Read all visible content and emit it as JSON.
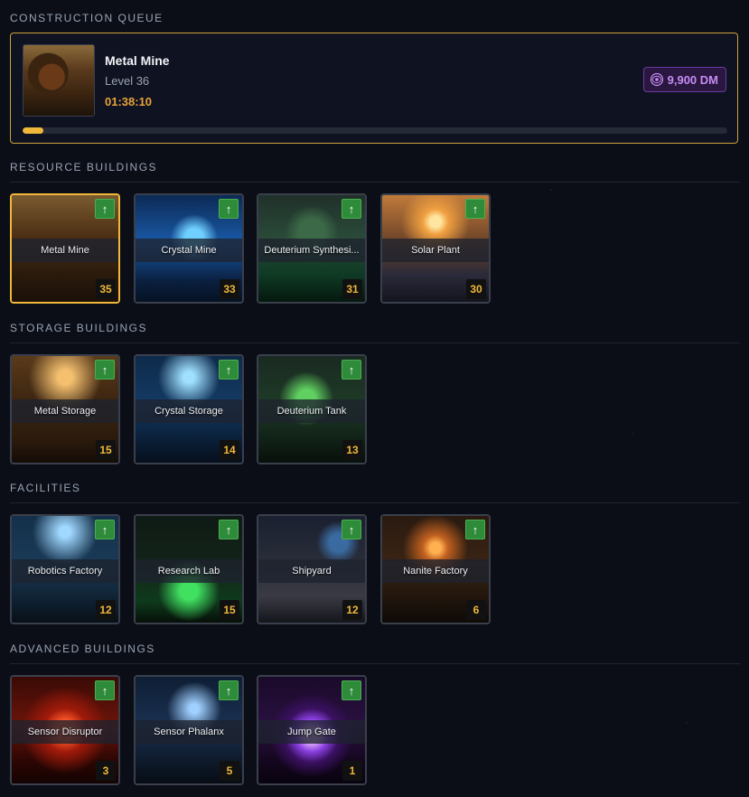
{
  "queue": {
    "section_title": "CONSTRUCTION QUEUE",
    "building_name": "Metal Mine",
    "level_text": "Level 36",
    "time_remaining": "01:38:10",
    "cost_label": "9,900 DM",
    "progress_percent": 3,
    "thumb_icon": "metal-mine-image"
  },
  "sections": [
    {
      "title": "RESOURCE BUILDINGS",
      "buildings": [
        {
          "name": "Metal Mine",
          "level": "35",
          "selected": true,
          "art": "metal"
        },
        {
          "name": "Crystal Mine",
          "level": "33",
          "selected": false,
          "art": "crystal"
        },
        {
          "name": "Deuterium Synthesi...",
          "level": "31",
          "selected": false,
          "art": "deuterium"
        },
        {
          "name": "Solar Plant",
          "level": "30",
          "selected": false,
          "art": "solar"
        }
      ]
    },
    {
      "title": "STORAGE BUILDINGS",
      "buildings": [
        {
          "name": "Metal Storage",
          "level": "15",
          "selected": false,
          "art": "metalstore"
        },
        {
          "name": "Crystal Storage",
          "level": "14",
          "selected": false,
          "art": "crystalstore"
        },
        {
          "name": "Deuterium Tank",
          "level": "13",
          "selected": false,
          "art": "deutank"
        }
      ]
    },
    {
      "title": "FACILITIES",
      "buildings": [
        {
          "name": "Robotics Factory",
          "level": "12",
          "selected": false,
          "art": "robotics"
        },
        {
          "name": "Research Lab",
          "level": "15",
          "selected": false,
          "art": "research"
        },
        {
          "name": "Shipyard",
          "level": "12",
          "selected": false,
          "art": "shipyard"
        },
        {
          "name": "Nanite Factory",
          "level": "6",
          "selected": false,
          "art": "nanite"
        }
      ]
    },
    {
      "title": "ADVANCED BUILDINGS",
      "buildings": [
        {
          "name": "Sensor Disruptor",
          "level": "3",
          "selected": false,
          "art": "disruptor"
        },
        {
          "name": "Sensor Phalanx",
          "level": "5",
          "selected": false,
          "art": "phalanx"
        },
        {
          "name": "Jump Gate",
          "level": "1",
          "selected": false,
          "art": "jumpgate"
        }
      ]
    }
  ],
  "upgrade_symbol": "↑",
  "colors": {
    "accent_gold": "#f0b83a",
    "upgrade_green": "#2e8b3a",
    "dark_matter_purple": "#c58cf2"
  }
}
